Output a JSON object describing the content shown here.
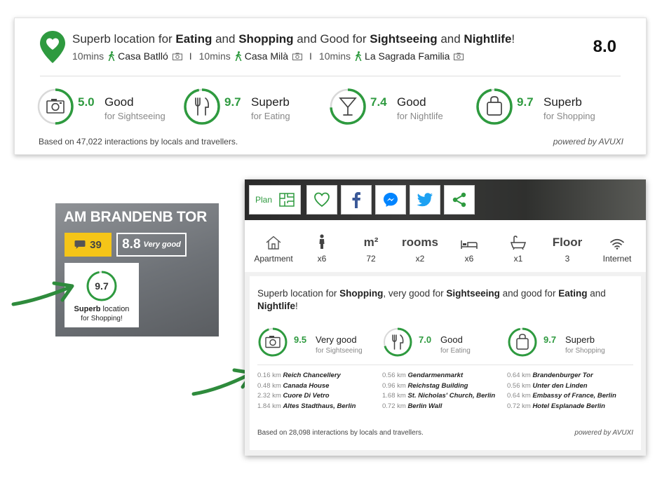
{
  "colors": {
    "accent_green": "#2e9a3f",
    "ring_gray": "#d9d9d9",
    "review_yellow": "#f5c518",
    "facebook": "#3b5998",
    "messenger": "#0084ff",
    "twitter": "#1da1f2"
  },
  "widget_large": {
    "headline_parts": [
      "Superb location for ",
      "Eating",
      " and ",
      "Shopping",
      " and Good for ",
      "Sightseeing",
      " and ",
      "Nightlife",
      "!"
    ],
    "landmarks": [
      {
        "time": "10mins",
        "name": "Casa Batlló"
      },
      {
        "time": "10mins",
        "name": "Casa Milà"
      },
      {
        "time": "10mins",
        "name": "La Sagrada Familia"
      }
    ],
    "separator": "I",
    "overall_score": "8.0",
    "categories": [
      {
        "score": "5.0",
        "fraction": 0.5,
        "label": "Good",
        "sublabel": "for Sightseeing",
        "icon": "camera-icon"
      },
      {
        "score": "9.7",
        "fraction": 0.97,
        "label": "Superb",
        "sublabel": "for Eating",
        "icon": "fork-knife-icon"
      },
      {
        "score": "7.4",
        "fraction": 0.74,
        "label": "Good",
        "sublabel": "for Nightlife",
        "icon": "cocktail-icon"
      },
      {
        "score": "9.7",
        "fraction": 0.97,
        "label": "Superb",
        "sublabel": "for Shopping",
        "icon": "shopping-bag-icon"
      }
    ],
    "footer": "Based on 47,022 interactions by locals and travellers.",
    "powered": "powered by AVUXI"
  },
  "hotel_tile": {
    "title": "AM BRANDENB TOR",
    "review_count": "39",
    "rating": "8.8",
    "rating_text": "Very good",
    "badge_score": "9.7",
    "badge_fraction": 0.97,
    "badge_line1_bold": "Superb",
    "badge_line1_rest": " location",
    "badge_line2": "for Shopping!"
  },
  "widget_detail": {
    "toolbar": {
      "plan_label": "Plan"
    },
    "amenities": [
      {
        "icon": "house-icon",
        "value": "Apartment"
      },
      {
        "icon": "person-icon",
        "value": "x6"
      },
      {
        "icon_text": "m²",
        "value": "72"
      },
      {
        "icon_text": "rooms",
        "value": "x2"
      },
      {
        "icon": "bed-icon",
        "value": "x6"
      },
      {
        "icon": "bathtub-icon",
        "value": "x1"
      },
      {
        "icon_text": "Floor",
        "value": "3"
      },
      {
        "icon": "wifi-icon",
        "value": "Internet"
      }
    ],
    "headline_parts": [
      "Superb location for ",
      "Shopping",
      ", very good for ",
      "Sightseeing",
      " and good for ",
      "Eating",
      " and ",
      "Nightlife",
      "!"
    ],
    "categories": [
      {
        "score": "9.5",
        "fraction": 0.95,
        "label": "Very good",
        "sublabel": "for Sightseeing",
        "icon": "camera-icon"
      },
      {
        "score": "7.0",
        "fraction": 0.7,
        "label": "Good",
        "sublabel": "for Eating",
        "icon": "fork-knife-icon"
      },
      {
        "score": "9.7",
        "fraction": 0.97,
        "label": "Superb",
        "sublabel": "for Shopping",
        "icon": "shopping-bag-icon"
      }
    ],
    "poi_columns": [
      [
        {
          "dist": "0.16 km",
          "name": "Reich Chancellery"
        },
        {
          "dist": "0.48 km",
          "name": "Canada House"
        },
        {
          "dist": "2.32 km",
          "name": "Cuore Di Vetro"
        },
        {
          "dist": "1.84 km",
          "name": "Altes Stadthaus, Berlin"
        }
      ],
      [
        {
          "dist": "0.56 km",
          "name": "Gendarmenmarkt"
        },
        {
          "dist": "0.96 km",
          "name": "Reichstag Building"
        },
        {
          "dist": "1.68 km",
          "name": "St. Nicholas' Church, Berlin"
        },
        {
          "dist": "0.72 km",
          "name": "Berlin Wall"
        }
      ],
      [
        {
          "dist": "0.64 km",
          "name": "Brandenburger Tor"
        },
        {
          "dist": "0.56 km",
          "name": "Unter den Linden"
        },
        {
          "dist": "0.64 km",
          "name": "Embassy of France, Berlin"
        },
        {
          "dist": "0.72 km",
          "name": "Hotel Esplanade Berlin"
        }
      ]
    ],
    "footer": "Based on 28,098 interactions by locals and travellers.",
    "powered": "powered by AVUXI"
  }
}
